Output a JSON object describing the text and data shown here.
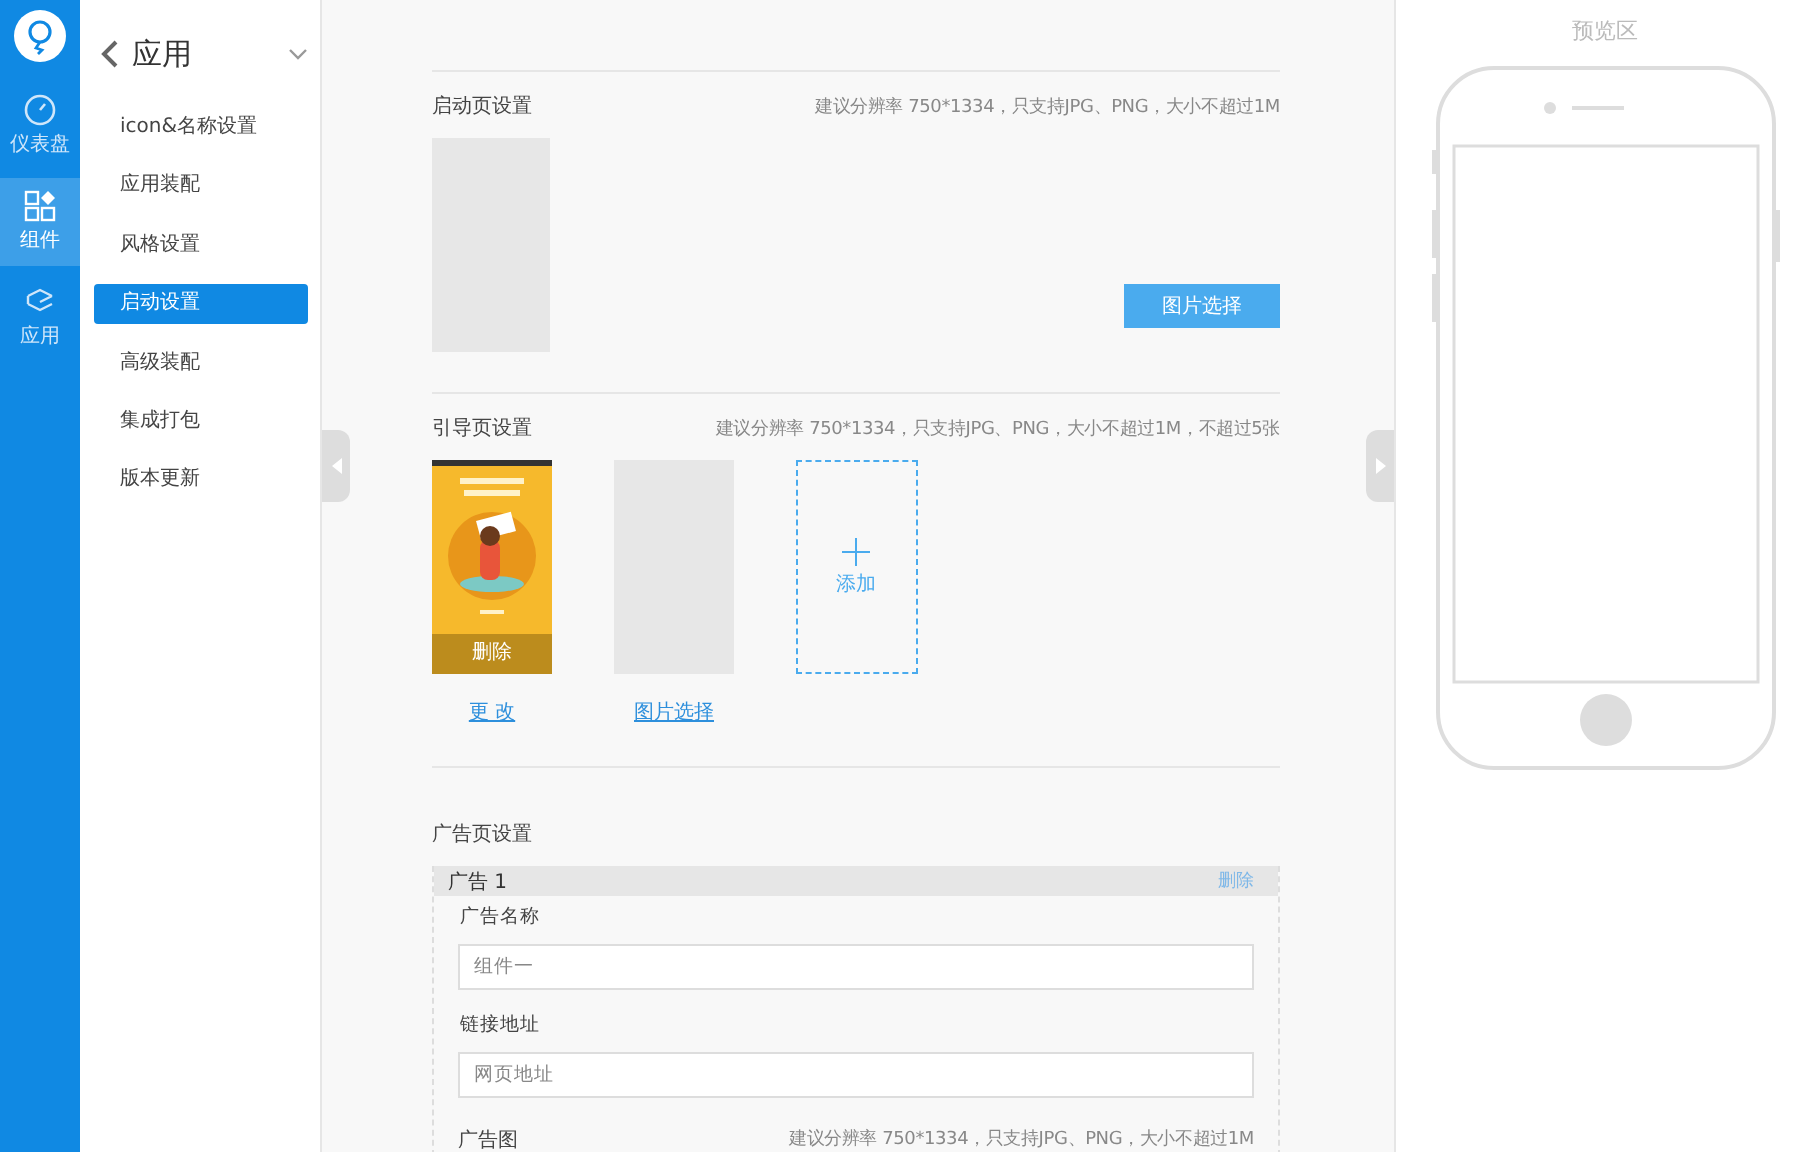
{
  "nav_rail": {
    "items": [
      {
        "label": "仪表盘",
        "selected": false
      },
      {
        "label": "组件",
        "selected": true
      },
      {
        "label": "应用",
        "selected": false
      }
    ]
  },
  "sub_nav": {
    "title": "应用",
    "items": [
      {
        "label": "icon&名称设置",
        "selected": false
      },
      {
        "label": "应用装配",
        "selected": false
      },
      {
        "label": "风格设置",
        "selected": false
      },
      {
        "label": "启动设置",
        "selected": true
      },
      {
        "label": "高级装配",
        "selected": false
      },
      {
        "label": "集成打包",
        "selected": false
      },
      {
        "label": "版本更新",
        "selected": false
      }
    ]
  },
  "startup": {
    "title": "启动页设置",
    "hint": "建议分辨率 750*1334，只支持JPG、PNG，大小不超过1M",
    "button": "图片选择"
  },
  "guide": {
    "title": "引导页设置",
    "hint": "建议分辨率 750*1334，只支持JPG、PNG，大小不超过1M，不超过5张",
    "slots": [
      {
        "kind": "picture",
        "overlay": "删除",
        "link": "更 改"
      },
      {
        "kind": "empty",
        "link": "图片选择"
      },
      {
        "kind": "add",
        "label": "添加"
      }
    ]
  },
  "ads": {
    "title": "广告页设置",
    "items": [
      {
        "title": "广告 1",
        "delete": "删除",
        "fields": [
          {
            "label": "广告名称",
            "placeholder": "组件一"
          },
          {
            "label": "链接地址",
            "placeholder": "网页地址"
          }
        ],
        "image_label": "广告图",
        "image_hint": "建议分辨率 750*1334，只支持JPG、PNG，大小不超过1M"
      }
    ]
  },
  "preview": {
    "title": "预览区"
  }
}
